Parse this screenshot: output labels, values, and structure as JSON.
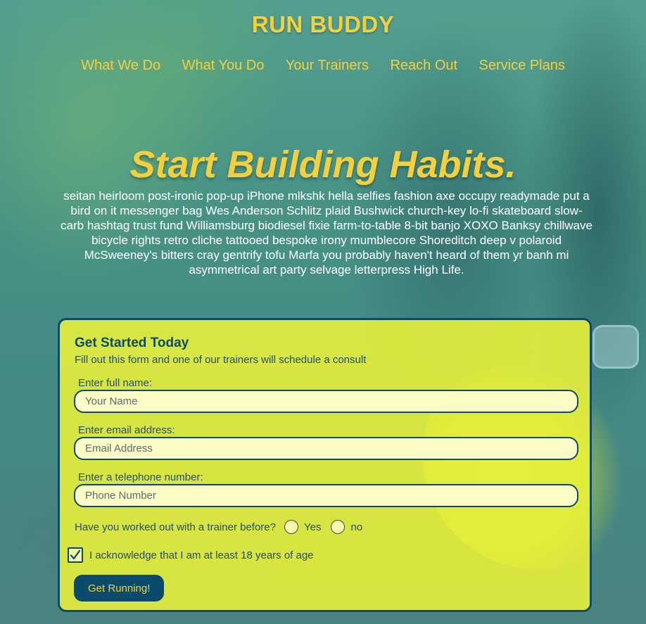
{
  "brand": {
    "name": "RUN BUDDY"
  },
  "nav": {
    "items": [
      {
        "label": "What We Do"
      },
      {
        "label": "What You Do"
      },
      {
        "label": "Your Trainers"
      },
      {
        "label": "Reach Out"
      },
      {
        "label": "Service Plans"
      }
    ]
  },
  "hero": {
    "title": "Start Building Habits.",
    "body": "seitan heirloom post-ironic pop-up iPhone mlkshk hella selfies fashion axe occupy readymade put a bird on it messenger bag Wes Anderson Schlitz plaid Bushwick church-key lo-fi skateboard slow-carb hashtag trust fund Williamsburg biodiesel fixie farm-to-table 8-bit banjo XOXO Banksy chillwave bicycle rights retro cliche tattooed bespoke irony mumblecore Shoreditch deep v polaroid McSweeney's bitters cray gentrify tofu Marfa you probably haven't heard of them yr banh mi asymmetrical art party selvage letterpress High Life."
  },
  "form": {
    "title": "Get Started Today",
    "subtitle": "Fill out this form and one of our trainers will schedule a consult",
    "name": {
      "label": "Enter full name:",
      "placeholder": "Your Name",
      "value": ""
    },
    "email": {
      "label": "Enter email address:",
      "placeholder": "Email Address",
      "value": ""
    },
    "phone": {
      "label": "Enter a telephone number:",
      "placeholder": "Phone Number",
      "value": ""
    },
    "trainer_question": {
      "label": "Have you worked out with a trainer before?",
      "options": [
        "Yes",
        "no"
      ],
      "selected": null
    },
    "age_ack": {
      "label": "I acknowledge that I am at least 18 years of age",
      "checked": true
    },
    "submit_label": "Get Running!"
  },
  "colors": {
    "accent_yellow": "#f4d03f",
    "navy": "#0b4a6a",
    "form_bg": "#f0f537"
  }
}
